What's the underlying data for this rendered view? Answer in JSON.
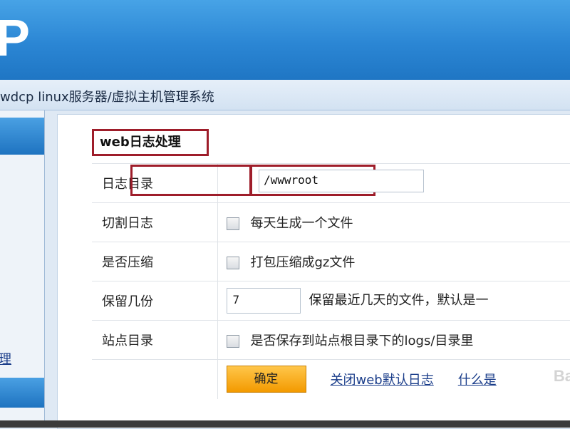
{
  "app": {
    "logo_text": "P",
    "system_title": "wdcp linux服务器/虚拟主机管理系统"
  },
  "sidebar": {
    "link_label": "理"
  },
  "form": {
    "section_title": "web日志处理",
    "rows": [
      {
        "label": "日志目录",
        "value": "/wwwroot"
      },
      {
        "label": "切割日志",
        "checkbox_label": "每天生成一个文件",
        "checked": false
      },
      {
        "label": "是否压缩",
        "checkbox_label": "打包压缩成gz文件",
        "checked": false
      },
      {
        "label": "保留几份",
        "value": "7",
        "hint": "保留最近几天的文件，默认是一"
      },
      {
        "label": "站点目录",
        "checkbox_label": "是否保存到站点根目录下的logs/目录里",
        "checked": false
      }
    ],
    "confirm_label": "确定",
    "link_close_default": "关闭web默认日志",
    "link_what": "什么是"
  },
  "watermark": "Ba",
  "colors": {
    "banner": "#2b86d4",
    "highlight_border": "#9e1d2a",
    "button": "#f39a00",
    "link": "#1a3d8a"
  }
}
